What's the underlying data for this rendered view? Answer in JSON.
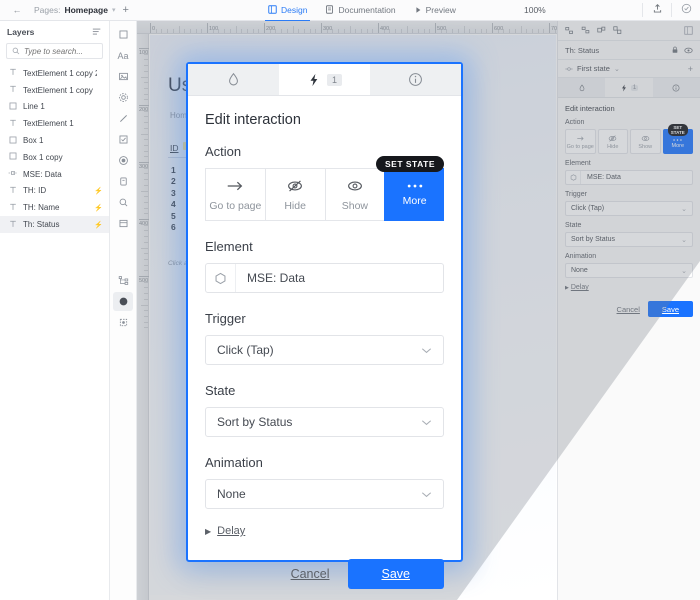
{
  "topbar": {
    "back_icon": "back-arrow-icon",
    "pages_label": "Pages:",
    "page_name": "Homepage",
    "chevron": "▾",
    "add_page": "+",
    "modes": [
      {
        "label": "Design",
        "icon": "design-icon",
        "active": true
      },
      {
        "label": "Documentation",
        "icon": "document-icon",
        "active": false
      },
      {
        "label": "Preview",
        "icon": "play-icon",
        "active": false
      }
    ],
    "zoom": "100%",
    "share_icon": "share-upload-icon",
    "check_icon": "check-circle-icon"
  },
  "layers_panel": {
    "title": "Layers",
    "sort_icon": "sort-icon",
    "search_placeholder": "Type to search...",
    "search_value": "",
    "search_icon": "search-icon",
    "items": [
      {
        "icon": "text-icon",
        "label": "TextElement 1 copy 2",
        "flag": "",
        "selected": false
      },
      {
        "icon": "text-icon",
        "label": "TextElement 1 copy",
        "flag": "",
        "selected": false
      },
      {
        "icon": "box-icon",
        "label": "Line 1",
        "flag": "",
        "selected": false
      },
      {
        "icon": "text-icon",
        "label": "TextElement 1",
        "flag": "",
        "selected": false
      },
      {
        "icon": "box-icon",
        "label": "Box 1",
        "flag": "",
        "selected": false
      },
      {
        "icon": "box-icon",
        "label": "Box 1 copy",
        "flag": "",
        "selected": false
      },
      {
        "icon": "multi-icon",
        "label": "MSE: Data",
        "flag": "",
        "selected": false
      },
      {
        "icon": "text-icon",
        "label": "TH: ID",
        "flag": "⚡",
        "selected": false
      },
      {
        "icon": "text-icon",
        "label": "TH: Name",
        "flag": "⚡",
        "selected": false
      },
      {
        "icon": "text-icon",
        "label": "Th: Status",
        "flag": "⚡",
        "selected": true
      }
    ]
  },
  "toolbar": {
    "tools": [
      {
        "name": "rectangle-tool-icon",
        "selected": false
      },
      {
        "name": "text-tool-icon",
        "selected": false
      },
      {
        "name": "image-tool-icon",
        "selected": false
      },
      {
        "name": "settings-tool-icon",
        "selected": false
      },
      {
        "name": "line-tool-icon",
        "selected": false
      },
      {
        "name": "checkbox-tool-icon",
        "selected": false
      },
      {
        "name": "radio-tool-icon",
        "selected": false
      },
      {
        "name": "button-tool-icon",
        "selected": false
      },
      {
        "name": "search-tool-icon",
        "selected": false
      },
      {
        "name": "table-tool-icon",
        "selected": false
      }
    ],
    "bottom_tools": [
      {
        "name": "hierarchy-tool-icon",
        "selected": false
      },
      {
        "name": "state-tool-icon",
        "selected": true
      },
      {
        "name": "component-tool-icon",
        "selected": false
      }
    ]
  },
  "canvas": {
    "ruler_h_ticks": [
      "0",
      "100",
      "200",
      "300",
      "400",
      "500",
      "600",
      "700"
    ],
    "ruler_v_ticks": [
      "100",
      "200",
      "300",
      "400",
      "500"
    ],
    "artboard": {
      "title": "Users",
      "nav": "Home",
      "column_header": "ID",
      "column_badge": "⚡",
      "rows": "1\n2\n3\n4\n5\n6",
      "hint": "Click a ..."
    }
  },
  "right_panel": {
    "icons": [
      "align-left-icon",
      "align-center-icon",
      "align-right-icon",
      "distribute-icon"
    ],
    "grid_icon": "grid-icon",
    "element_name": "Th: Status",
    "lock_icon": "lock-icon",
    "eye_icon": "eye-icon",
    "state_name": "First state",
    "state_chevron": "⌄",
    "state_prefix_icon": "state-icon",
    "add_state": "+",
    "tabs": [
      {
        "icon": "droplet-icon",
        "badge": "",
        "active": false
      },
      {
        "icon": "lightning-icon",
        "badge": "1",
        "active": true
      },
      {
        "icon": "info-icon",
        "badge": "",
        "active": false
      }
    ],
    "heading": "Edit interaction",
    "action_label": "Action",
    "actions": [
      {
        "icon": "arrow-right-icon",
        "label": "Go to page",
        "active": false
      },
      {
        "icon": "eye-off-icon",
        "label": "Hide",
        "active": false
      },
      {
        "icon": "eye-icon",
        "label": "Show",
        "active": false
      },
      {
        "icon": "dots-icon",
        "label": "More",
        "active": true,
        "tooltip": "SET STATE"
      }
    ],
    "element_label": "Element",
    "element_value": "MSE: Data",
    "element_icon": "hexagon-icon",
    "trigger_label": "Trigger",
    "trigger_value": "Click (Tap)",
    "state_label": "State",
    "state_value": "Sort by Status",
    "animation_label": "Animation",
    "animation_value": "None",
    "delay_label": "Delay",
    "delay_arrow": "▶",
    "cancel_label": "Cancel",
    "save_label": "Save"
  },
  "modal": {
    "tabs": [
      {
        "icon": "droplet-icon",
        "badge": "",
        "active": false
      },
      {
        "icon": "lightning-icon",
        "badge": "1",
        "active": true
      },
      {
        "icon": "info-icon",
        "badge": "",
        "active": false
      }
    ],
    "title": "Edit interaction",
    "action_label": "Action",
    "actions": [
      {
        "icon": "arrow-right-icon",
        "label": "Go to page",
        "active": false,
        "tooltip": ""
      },
      {
        "icon": "eye-off-icon",
        "label": "Hide",
        "active": false,
        "tooltip": ""
      },
      {
        "icon": "eye-icon",
        "label": "Show",
        "active": false,
        "tooltip": ""
      },
      {
        "icon": "dots-icon",
        "label": "More",
        "active": true,
        "tooltip": "SET STATE"
      }
    ],
    "element_label": "Element",
    "element_value": "MSE: Data",
    "element_icon": "hexagon-icon",
    "trigger_label": "Trigger",
    "trigger_value": "Click (Tap)",
    "state_label": "State",
    "state_value": "Sort by Status",
    "animation_label": "Animation",
    "animation_value": "None",
    "delay_label": "Delay",
    "delay_arrow": "▶",
    "cancel_label": "Cancel",
    "save_label": "Save",
    "chevron": "⌄"
  },
  "colors": {
    "accent_blue": "#1a73ff",
    "tooltip_black": "#16181c",
    "panel_gray": "#fafafa",
    "border": "#e2e4e8"
  }
}
